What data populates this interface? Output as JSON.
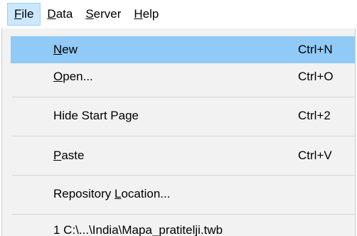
{
  "menubar": {
    "items": [
      {
        "mnemonic": "F",
        "rest": "ile",
        "active": true
      },
      {
        "mnemonic": "D",
        "rest": "ata",
        "active": false
      },
      {
        "mnemonic": "S",
        "rest": "erver",
        "active": false
      },
      {
        "mnemonic": "H",
        "rest": "elp",
        "active": false
      }
    ]
  },
  "file_menu": {
    "new": {
      "mnemonic": "N",
      "rest": "ew",
      "shortcut": "Ctrl+N"
    },
    "open": {
      "mnemonic": "O",
      "rest": "pen...",
      "shortcut": "Ctrl+O"
    },
    "hide_start_page": {
      "label": "Hide Start Page",
      "shortcut": "Ctrl+2"
    },
    "paste": {
      "mnemonic": "P",
      "rest": "aste",
      "shortcut": "Ctrl+V"
    },
    "repository_location": {
      "prefix": "Repository ",
      "mnemonic": "L",
      "rest": "ocation..."
    },
    "recent_file": {
      "label": "1 C:\\...\\India\\Mapa_pratitelji.twb"
    }
  },
  "colors": {
    "highlight": "#91c9f7",
    "active_menubar": "#cce8ff",
    "menu_background": "#f2f2f2",
    "separator": "#d7d7d7"
  }
}
